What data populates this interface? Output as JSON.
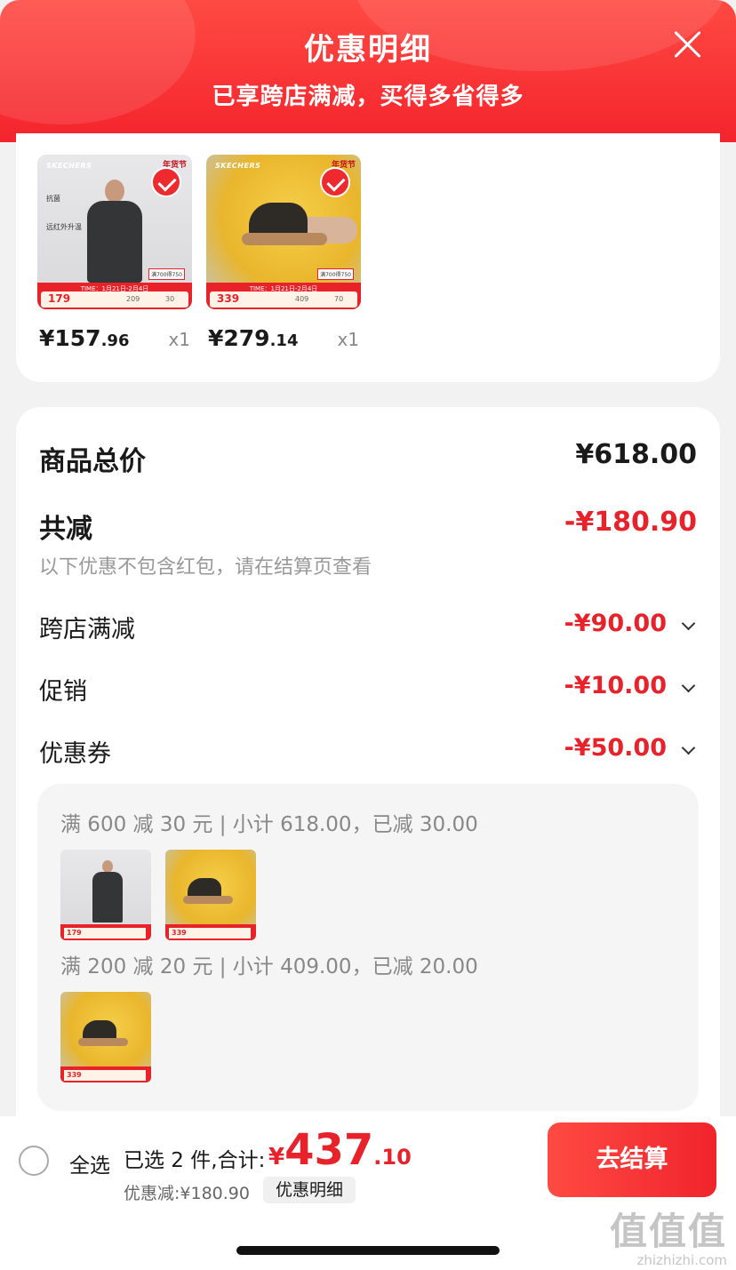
{
  "header": {
    "title": "优惠明细",
    "subtitle": "已享跨店满减，买得多省得多"
  },
  "products": [
    {
      "brand": "SKECHERS",
      "badge": "年货节",
      "features": [
        "抗菌",
        "远红外升温"
      ],
      "banner_time": "TIME：1月21日-2月4日",
      "banner_price": "179",
      "banner_orig": "209",
      "banner_cut": "30",
      "tag": "满700得750",
      "price_int": "¥157",
      "price_dec": ".96",
      "qty": "x1"
    },
    {
      "brand": "SKECHERS",
      "badge": "年货节",
      "banner_time": "TIME：1月21日-2月4日",
      "banner_price": "339",
      "banner_orig": "409",
      "banner_cut": "70",
      "tag": "满700得750",
      "price_int": "¥279",
      "price_dec": ".14",
      "qty": "x1"
    }
  ],
  "summary": {
    "total_label": "商品总价",
    "total_value": "¥618.00",
    "reduce_label": "共减",
    "reduce_value": "-¥180.90",
    "note": "以下优惠不包含红包，请在结算页查看",
    "items": [
      {
        "label": "跨店满减",
        "value": "-¥90.00"
      },
      {
        "label": "促销",
        "value": "-¥10.00"
      },
      {
        "label": "优惠券",
        "value": "-¥50.00"
      }
    ]
  },
  "detail": {
    "rule1": "满 600 减 30 元 | 小计 618.00，已减 30.00",
    "rule2": "满 200 减 20 元 | 小计 409.00，已减 20.00",
    "mini_prices": [
      "179",
      "339",
      "339"
    ]
  },
  "bottom": {
    "select_all": "全选",
    "selected_text": "已选 2 件,合计:",
    "total_yen": "¥",
    "total_int": "437",
    "total_dec": ".10",
    "discount_text": "优惠减:¥180.90",
    "detail_button": "优惠明细",
    "checkout_button": "去结算"
  },
  "watermark": {
    "logo": "值值值",
    "site": "zhizhizhi.com"
  },
  "colors": {
    "accent_red": "#e8222a",
    "header_red": "#f4242c"
  }
}
